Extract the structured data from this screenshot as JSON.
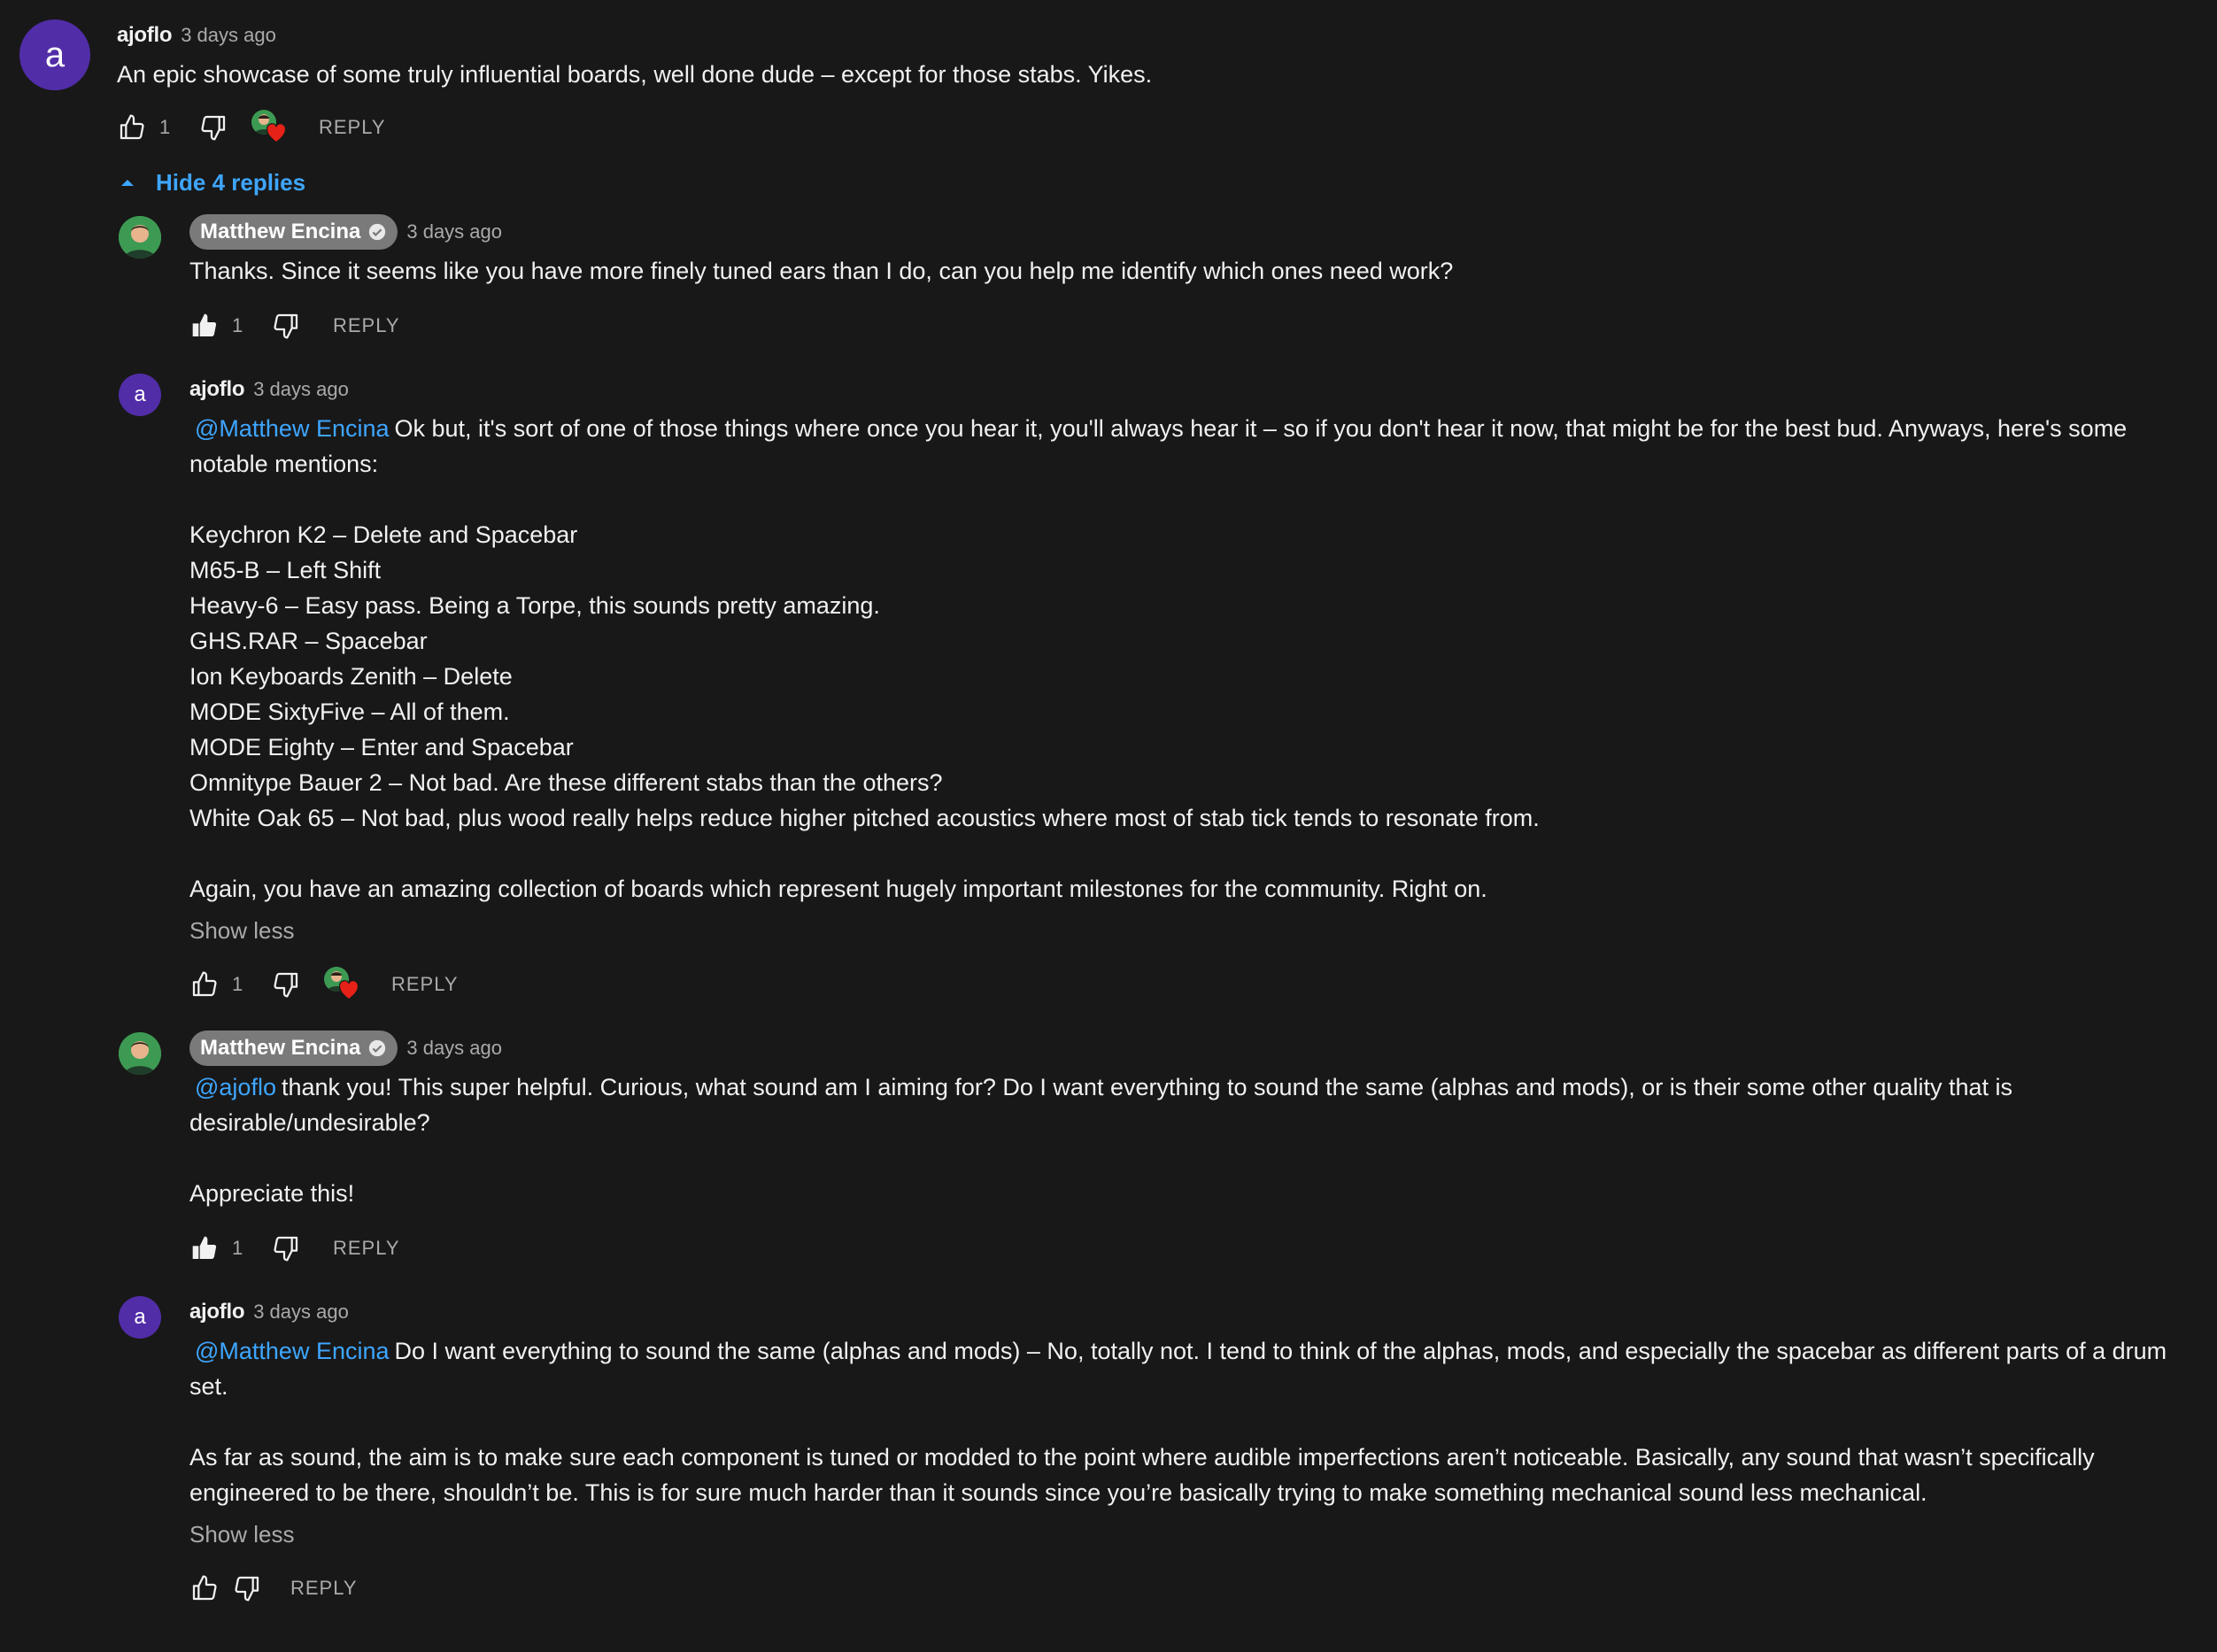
{
  "top_comment": {
    "avatar_letter": "a",
    "author": "ajoflo",
    "timestamp": "3 days ago",
    "text": "An epic showcase of some truly influential boards, well done dude – except for those stabs. Yikes.",
    "like_count": "1",
    "reply_label": "REPLY"
  },
  "hide_replies_label": "Hide 4 replies",
  "replies": [
    {
      "author": "Matthew Encina",
      "timestamp": "3 days ago",
      "mention": "",
      "text": "Thanks. Since it seems like you have more finely tuned ears than I do, can you help me identify which ones need work?",
      "like_count": "1",
      "reply_label": "REPLY"
    },
    {
      "avatar_letter": "a",
      "author": "ajoflo",
      "timestamp": "3 days ago",
      "mention": "@Matthew Encina",
      "text": "Ok but, it's sort of one of those things where once you hear it, you'll always hear it – so if you don't hear it now, that might be for the best bud. Anyways, here's some notable mentions:\n\nKeychron K2 – Delete and Spacebar\nM65-B – Left Shift\nHeavy-6 – Easy pass. Being a Torpe, this sounds pretty amazing.\nGHS.RAR – Spacebar\nIon Keyboards Zenith – Delete\nMODE SixtyFive – All of them.\nMODE Eighty – Enter and Spacebar\nOmnitype Bauer 2 – Not bad. Are these different stabs than the others?\nWhite Oak 65 – Not bad, plus wood really helps reduce higher pitched acoustics where most of stab tick tends to resonate from.\n\nAgain, you have an amazing collection of boards which represent hugely important milestones for the community. Right on.",
      "show_less": "Show less",
      "like_count": "1",
      "reply_label": "REPLY"
    },
    {
      "author": "Matthew Encina",
      "timestamp": "3 days ago",
      "mention": "@ajoflo",
      "text": "thank you! This super helpful. Curious, what sound am I aiming for? Do I want everything to sound the same (alphas and mods), or is their some other quality that is desirable/undesirable?\n\nAppreciate this!",
      "like_count": "1",
      "reply_label": "REPLY"
    },
    {
      "avatar_letter": "a",
      "author": "ajoflo",
      "timestamp": "3 days ago",
      "mention": "@Matthew Encina",
      "text": "Do I want everything to sound the same (alphas and mods) – No, totally not. I tend to think of the alphas, mods, and especially the spacebar as different parts of a drum set.\n\nAs far as sound, the aim is to make sure each component is tuned or modded to the point where audible imperfections aren’t noticeable. Basically, any sound that wasn’t specifically engineered to be there, shouldn’t be. This is for sure much harder than it sounds since you’re basically trying to make something mechanical sound less mechanical.",
      "show_less": "Show less",
      "like_count": "",
      "reply_label": "REPLY"
    }
  ],
  "colors": {
    "background": "#181818",
    "text": "#f1f1f1",
    "secondary": "#aaaaaa",
    "link": "#3ea6ff",
    "avatar_purple": "#512da8",
    "creator_chip": "#7a7a7a",
    "heart": "#e62117"
  }
}
